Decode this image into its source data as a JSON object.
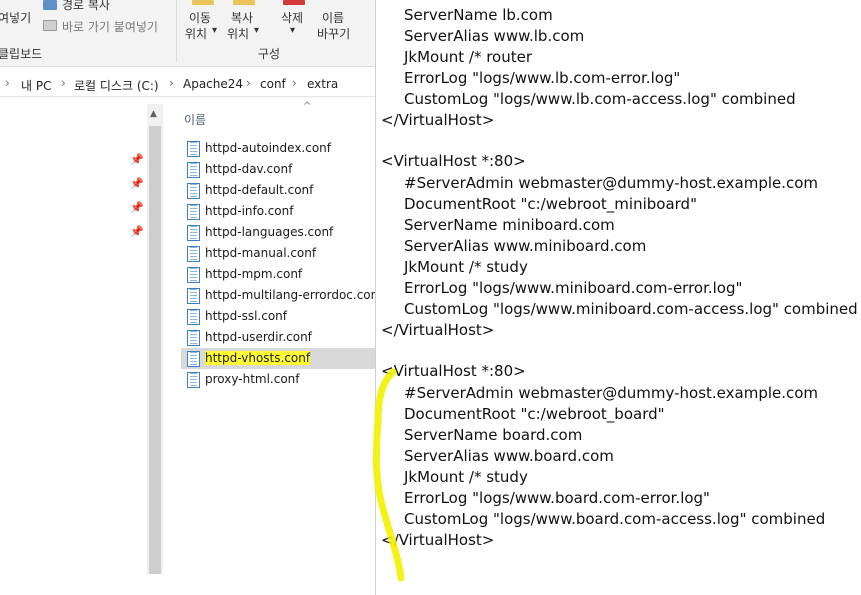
{
  "ribbon": {
    "paste_label": "여넣기",
    "copy_path_label": "경로 복사",
    "paste_shortcut_label": "바로 가기 붙여넣기",
    "clipboard_group": "클립보드",
    "move_to_label_1": "이동",
    "move_to_label_2": "위치",
    "copy_to_label_1": "복사",
    "copy_to_label_2": "위치",
    "delete_label": "삭제",
    "rename_label_1": "이름",
    "rename_label_2": "바꾸기",
    "organize_group": "구성",
    "dropdown_arrow": "▾"
  },
  "address": {
    "crumbs": [
      "내 PC",
      "로컬 디스크 (C:)",
      "Apache24",
      "conf",
      "extra"
    ],
    "separator": "›"
  },
  "filelist": {
    "column_name": "이름",
    "files": [
      "httpd-autoindex.conf",
      "httpd-dav.conf",
      "httpd-default.conf",
      "httpd-info.conf",
      "httpd-languages.conf",
      "httpd-manual.conf",
      "httpd-mpm.conf",
      "httpd-multilang-errordoc.conf",
      "httpd-ssl.conf",
      "httpd-userdir.conf",
      "httpd-vhosts.conf",
      "proxy-html.conf"
    ],
    "selected_file": "httpd-vhosts.conf"
  },
  "editor": {
    "lines": [
      "ServerName lb.com",
      "ServerAlias www.lb.com",
      "JkMount /* router",
      "ErrorLog \"logs/www.lb.com-error.log\"",
      "CustomLog \"logs/www.lb.com-access.log\" combined",
      "</VirtualHost>",
      "",
      "<VirtualHost *:80>",
      "#ServerAdmin webmaster@dummy-host.example.com",
      "DocumentRoot \"c:/webroot_miniboard\"",
      "ServerName miniboard.com",
      "ServerAlias www.miniboard.com",
      "JkMount /* study",
      "ErrorLog \"logs/www.miniboard.com-error.log\"",
      "CustomLog \"logs/www.miniboard.com-access.log\" combined",
      "</VirtualHost>",
      "",
      "<VirtualHost *:80>",
      "#ServerAdmin webmaster@dummy-host.example.com",
      "DocumentRoot \"c:/webroot_board\"",
      "ServerName board.com",
      "ServerAlias www.board.com",
      "JkMount /* study",
      "ErrorLog \"logs/www.board.com-error.log\"",
      "CustomLog \"logs/www.board.com-access.log\" combined",
      "</VirtualHost>"
    ]
  },
  "colors": {
    "highlight": "#ffff33",
    "selection": "#d9d9d9",
    "ribbon_bg": "#f3f3f3"
  }
}
